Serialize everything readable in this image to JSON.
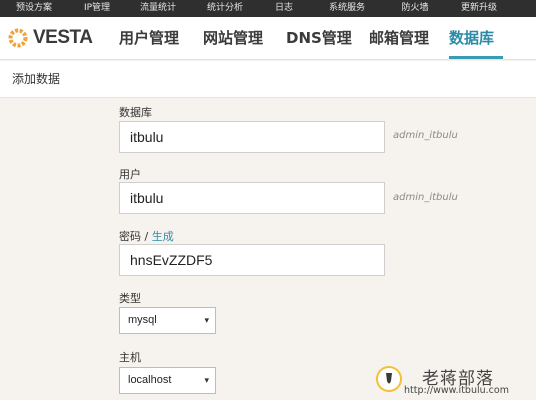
{
  "topbar": {
    "items": [
      "预设方案",
      "IP管理",
      "流量统计",
      "统计分析",
      "日志",
      "系统服务",
      "防火墙",
      "更新升级"
    ]
  },
  "header": {
    "logo_text": "VESTA",
    "nav": [
      "用户管理",
      "网站管理",
      "DNS管理",
      "邮箱管理",
      "数据库"
    ]
  },
  "subbar": {
    "title": "添加数据"
  },
  "form": {
    "database_label": "数据库",
    "database_value": "itbulu",
    "database_hint": "admin_itbulu",
    "user_label": "用户",
    "user_value": "itbulu",
    "user_hint": "admin_itbulu",
    "password_label": "密码",
    "password_sep": " / ",
    "password_generate": "生成",
    "password_value": "hnsEvZZDF5",
    "type_label": "类型",
    "type_value": "mysql",
    "host_label": "主机",
    "host_value": "localhost"
  },
  "watermark": {
    "title": "老蒋部落",
    "url": "http://www.itbulu.com"
  },
  "colors": {
    "topbar_bg": "#2f2f2f",
    "accent": "#2b8aa5",
    "page_bg": "#f6f3ee",
    "logo_orange": "#f0a33c"
  }
}
